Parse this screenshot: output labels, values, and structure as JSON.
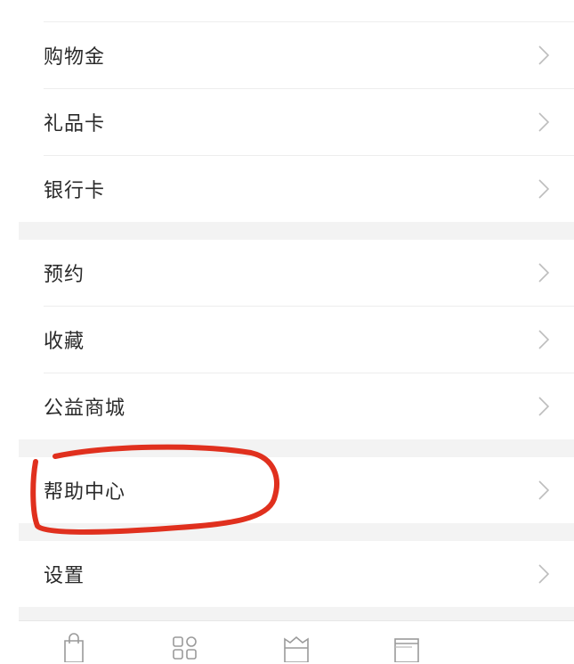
{
  "menu": {
    "items": [
      {
        "label": "购物金"
      },
      {
        "label": "礼品卡"
      },
      {
        "label": "银行卡"
      },
      {
        "label": "预约"
      },
      {
        "label": "收藏"
      },
      {
        "label": "公益商城"
      },
      {
        "label": "帮助中心"
      },
      {
        "label": "设置"
      }
    ],
    "chevron_icon": "chevron-right-icon"
  },
  "tabbar": {
    "tabs": [
      {
        "icon": "shopping-bag-icon"
      },
      {
        "icon": "categories-icon"
      },
      {
        "icon": "cart-icon"
      },
      {
        "icon": "messages-icon"
      }
    ]
  },
  "annotation": {
    "color": "#e0301e",
    "target": "帮助中心"
  },
  "colors": {
    "background": "#ffffff",
    "section_gap": "#f3f3f3",
    "text": "#2a2a2a",
    "chevron": "#bdbdbd",
    "annotation": "#e0301e"
  }
}
